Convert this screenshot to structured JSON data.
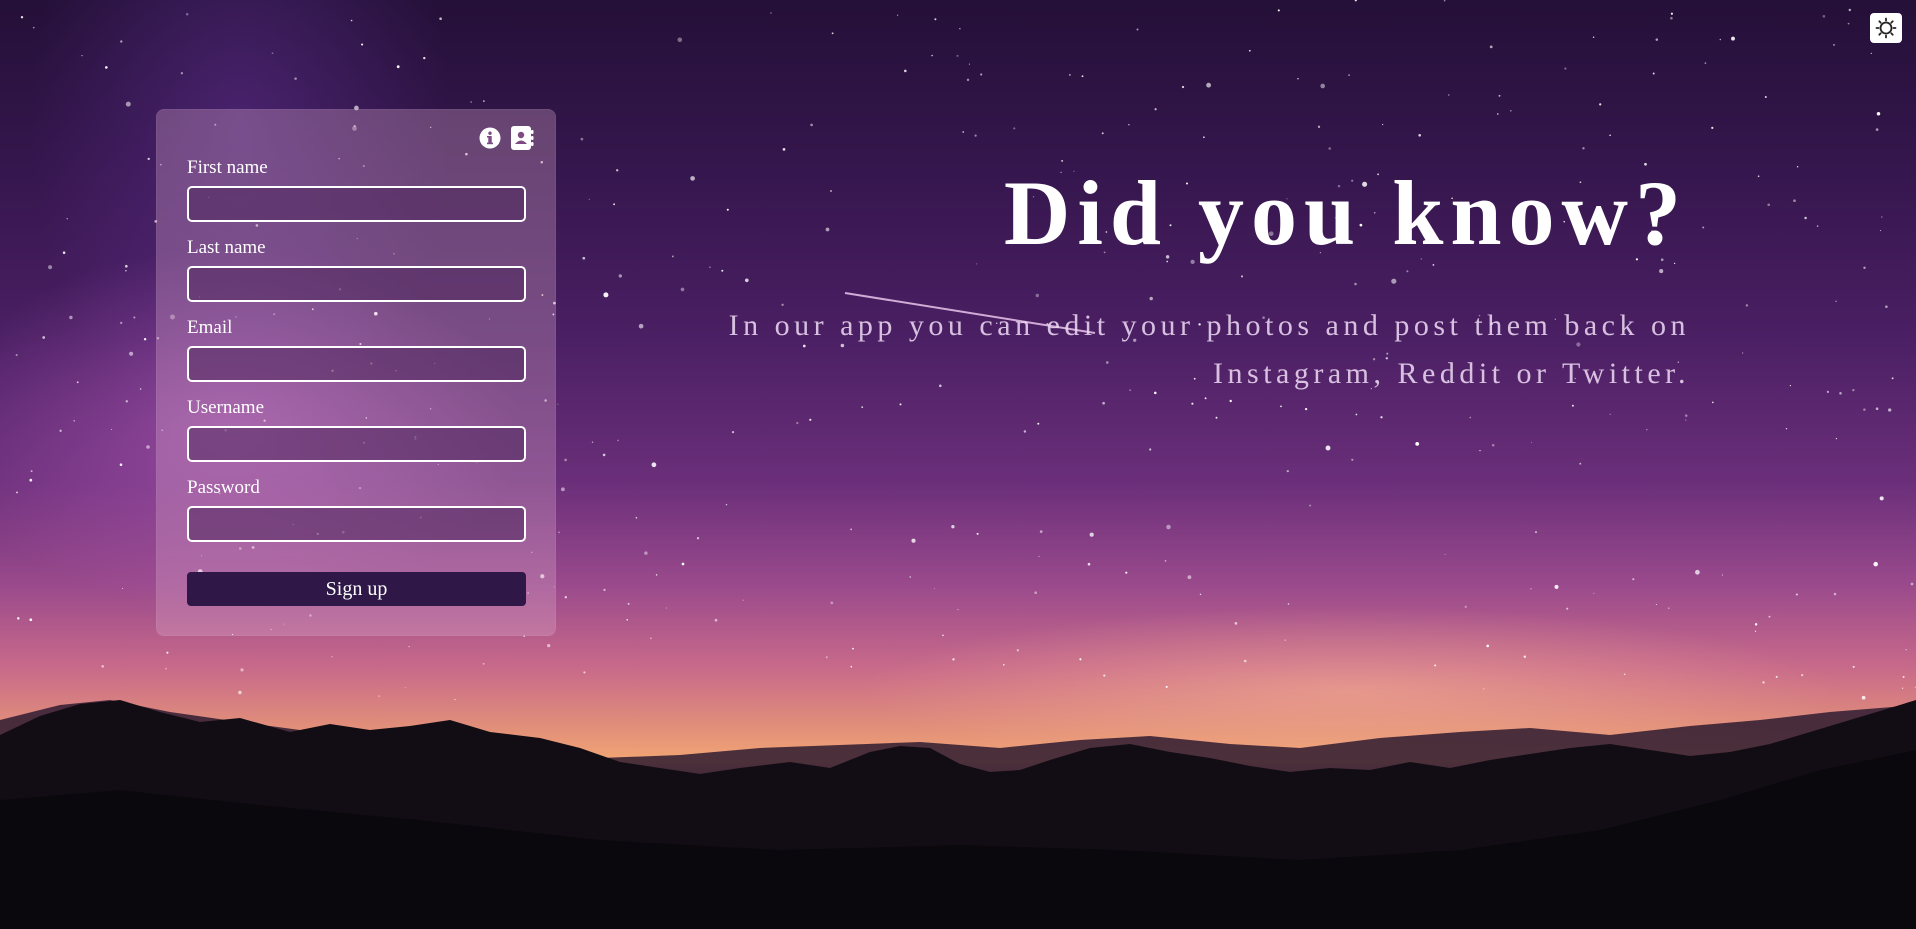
{
  "colors": {
    "sky_top": "#241038",
    "sky_horizon": "#f3a674",
    "card_bg": "rgba(220,170,205,0.32)",
    "button_bg": "#2f1748",
    "text": "#ffffff"
  },
  "header": {
    "theme_toggle_icon": "sun-icon"
  },
  "signup": {
    "icons": [
      "info-icon",
      "contact-book-icon"
    ],
    "fields": {
      "first_name": {
        "label": "First name",
        "value": "",
        "placeholder": ""
      },
      "last_name": {
        "label": "Last name",
        "value": "",
        "placeholder": ""
      },
      "email": {
        "label": "Email",
        "value": "",
        "placeholder": ""
      },
      "username": {
        "label": "Username",
        "value": "",
        "placeholder": ""
      },
      "password": {
        "label": "Password",
        "value": "",
        "placeholder": ""
      }
    },
    "submit_label": "Sign up"
  },
  "hero": {
    "title": "Did you know?",
    "text": "In our app you can edit your photos and post them back on Instagram, Reddit or Twitter."
  }
}
